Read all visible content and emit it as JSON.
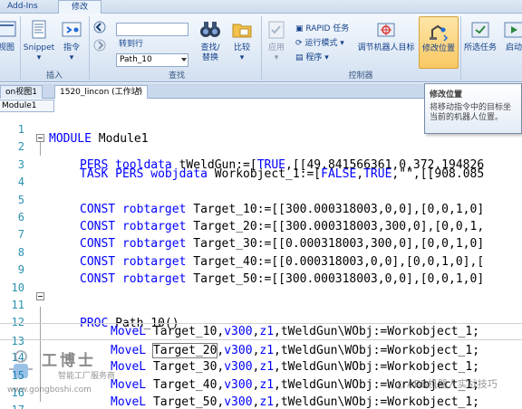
{
  "ribbon": {
    "tabs": [
      {
        "label": "Add-Ins"
      },
      {
        "label": "修改"
      }
    ],
    "groups": {
      "insert": "插入",
      "find": "查找",
      "controller": "控制器"
    },
    "buttons": {
      "view": "视图",
      "snippet": "Snippet",
      "instruction": "指令",
      "find_replace_line1": "查找/",
      "find_replace_line2": "替换",
      "compare": "比较",
      "apply": "应用",
      "rapid_task": "RAPID 任务",
      "run_mode": "运行模式",
      "program": "程序",
      "adjust_robot_target": "调节机器人目标",
      "modify_position": "修改位置",
      "selected_task": "所选任务",
      "start": "启动"
    },
    "goto_input": {
      "value": ""
    },
    "goto_label": "转到行",
    "routine_select": {
      "value": "Path_10"
    }
  },
  "doc_tabs": [
    {
      "label": "on视图1"
    },
    {
      "label": "1520_lincon (工作站)"
    }
  ],
  "module_tab": "Module1",
  "tooltip": {
    "title": "修改位置",
    "body": "将移动指令中的目标坐当前的机器人位置。"
  },
  "code_lines": [
    {
      "n": "1",
      "text": "MODULE Module1"
    },
    {
      "n": "2",
      "text": "PERS tooldata tWeldGun:=[TRUE,[[49.841566361,0,372.194826"
    },
    {
      "n": "3",
      "text": "TASK PERS wobjdata Workobject_1:=[FALSE,TRUE,\"\",[[908.085"
    },
    {
      "n": "4",
      "text": ""
    },
    {
      "n": "5",
      "text": "CONST robtarget Target_10:=[[300.000318003,0,0],[0,0,1,0]"
    },
    {
      "n": "6",
      "text": "CONST robtarget Target_20:=[[300.000318003,300,0],[0,0,1,"
    },
    {
      "n": "7",
      "text": "CONST robtarget Target_30:=[[0.000318003,300,0],[0,0,1,0]"
    },
    {
      "n": "8",
      "text": "CONST robtarget Target_40:=[[0.000318003,0,0],[0,0,1,0],["
    },
    {
      "n": "9",
      "text": "CONST robtarget Target_50:=[[300.000318003,0,0],[0,0,1,0]"
    },
    {
      "n": "10",
      "text": ""
    },
    {
      "n": "11",
      "text": "PROC Path_10()"
    },
    {
      "n": "12",
      "text": "MoveL Target_10,v300,z1,tWeldGun\\WObj:=Workobject_1;"
    },
    {
      "n": "13",
      "text": "MoveL Target_20,v300,z1,tWeldGun\\WObj:=Workobject_1;"
    },
    {
      "n": "14",
      "text": "MoveL Target_30,v300,z1,tWeldGun\\WObj:=Workobject_1;"
    },
    {
      "n": "15",
      "text": "MoveL Target_40,v300,z1,tWeldGun\\WObj:=Workobject_1;"
    },
    {
      "n": "16",
      "text": "MoveL Target_50,v300,z1,tWeldGun\\WObj:=Workobject_1;"
    },
    {
      "n": "17",
      "text": "ENDPROC"
    }
  ],
  "watermarks": {
    "left_title": "工博士",
    "left_sub": "智能工厂服务商",
    "left_url": "www.gongboshi.com",
    "right": "ABB机器人实战技巧"
  },
  "colors": {
    "keyword": "#0000ff",
    "line_number": "#2b91af",
    "highlight_button": "#f9c863"
  }
}
